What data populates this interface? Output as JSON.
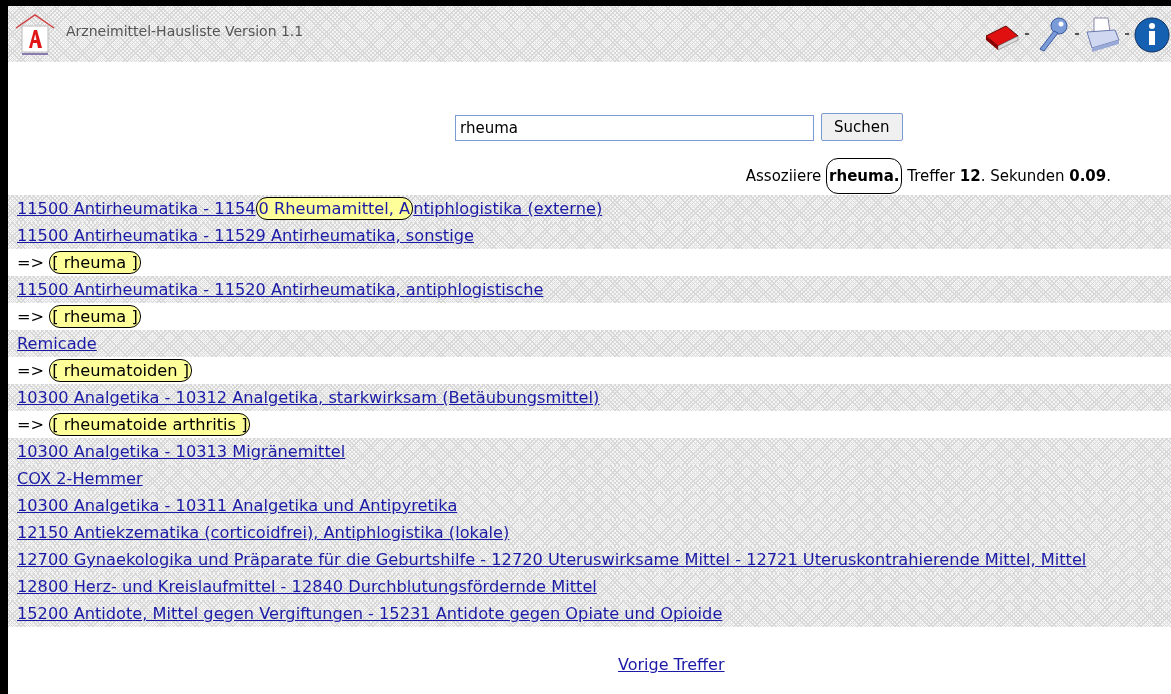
{
  "header": {
    "title": "Arzneimittel-Hausliste Version 1.1",
    "tools": [
      {
        "kind": "book"
      },
      {
        "kind": "key"
      },
      {
        "kind": "printer"
      },
      {
        "kind": "info"
      }
    ]
  },
  "search": {
    "value": "rheuma",
    "button": "Suchen"
  },
  "status": [
    {
      "text": "Assoziiere ",
      "bold": false,
      "circled": false
    },
    {
      "text": "rheuma.",
      "bold": true,
      "circled": true
    },
    {
      "text": " Treffer ",
      "bold": false,
      "circled": false
    },
    {
      "text": "12",
      "bold": true,
      "circled": false
    },
    {
      "text": ". Sekunden ",
      "bold": false,
      "circled": false
    },
    {
      "text": "0.09",
      "bold": true,
      "circled": false
    },
    {
      "text": ".",
      "bold": false,
      "circled": false
    }
  ],
  "results": [
    {
      "kind": "link",
      "parts": [
        {
          "text": "11500 Antirheumatika - 1154",
          "highlight": false,
          "circled": false
        },
        {
          "text": "0 Rheumamittel, A",
          "highlight": true,
          "circled": true
        },
        {
          "text": "ntiphlogistika (externe)",
          "highlight": false,
          "circled": false
        }
      ]
    },
    {
      "kind": "link",
      "parts": [
        {
          "text": "11500 Antirheumatika - 11529 Antirheumatika, sonstige",
          "highlight": false,
          "circled": false
        }
      ]
    },
    {
      "kind": "synonym",
      "parts": [
        {
          "text": "=> ",
          "highlight": false,
          "circled": false
        },
        {
          "text": "[ rheuma ]",
          "highlight": true,
          "circled": true
        }
      ]
    },
    {
      "kind": "link",
      "parts": [
        {
          "text": "11500 Antirheumatika - 11520 Antirheumatika, antiphlogistische",
          "highlight": false,
          "circled": false
        }
      ]
    },
    {
      "kind": "synonym",
      "parts": [
        {
          "text": "=> ",
          "highlight": false,
          "circled": false
        },
        {
          "text": "[ rheuma ]",
          "highlight": true,
          "circled": true
        }
      ]
    },
    {
      "kind": "link",
      "parts": [
        {
          "text": "Remicade",
          "highlight": false,
          "circled": false
        }
      ]
    },
    {
      "kind": "synonym",
      "parts": [
        {
          "text": "=> ",
          "highlight": false,
          "circled": false
        },
        {
          "text": "[ rheumatoiden ]",
          "highlight": true,
          "circled": true
        }
      ]
    },
    {
      "kind": "link",
      "parts": [
        {
          "text": "10300 Analgetika - 10312 Analgetika, starkwirksam (Betäubungsmittel)",
          "highlight": false,
          "circled": false
        }
      ]
    },
    {
      "kind": "synonym",
      "parts": [
        {
          "text": "=> ",
          "highlight": false,
          "circled": false
        },
        {
          "text": "[ rheumatoide arthritis ]",
          "highlight": true,
          "circled": true
        }
      ]
    },
    {
      "kind": "link",
      "parts": [
        {
          "text": "10300 Analgetika - 10313 Migränemittel",
          "highlight": false,
          "circled": false
        }
      ]
    },
    {
      "kind": "link",
      "parts": [
        {
          "text": "COX 2-Hemmer",
          "highlight": false,
          "circled": false
        }
      ]
    },
    {
      "kind": "link",
      "parts": [
        {
          "text": "10300 Analgetika - 10311 Analgetika und Antipyretika",
          "highlight": false,
          "circled": false
        }
      ]
    },
    {
      "kind": "link",
      "parts": [
        {
          "text": "12150 Antiekzematika (corticoidfrei), Antiphlogistika (lokale)",
          "highlight": false,
          "circled": false
        }
      ]
    },
    {
      "kind": "link",
      "parts": [
        {
          "text": "12700 Gynaekologika und Präparate für die Geburtshilfe - 12720 Uteruswirksame Mittel - 12721 Uteruskontrahierende Mittel, Mittel",
          "highlight": false,
          "circled": false
        }
      ]
    },
    {
      "kind": "link",
      "parts": [
        {
          "text": "12800 Herz- und Kreislaufmittel - 12840 Durchblutungsfördernde Mittel",
          "highlight": false,
          "circled": false
        }
      ]
    },
    {
      "kind": "link",
      "parts": [
        {
          "text": "15200 Antidote, Mittel gegen Vergiftungen - 15231 Antidote gegen Opiate und Opioide",
          "highlight": false,
          "circled": false
        }
      ]
    }
  ],
  "pager": {
    "label": "Vorige Treffer"
  }
}
